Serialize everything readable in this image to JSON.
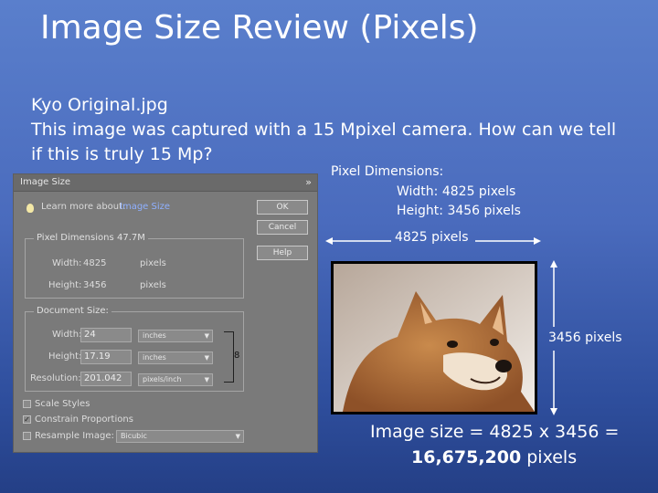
{
  "slide": {
    "title": "Image Size Review (Pixels)",
    "lines": [
      "Kyo Original.jpg",
      "This image was captured with a 15 Mpixel camera.  How can we tell",
      "if this is truly 15 Mp?"
    ]
  },
  "dialog": {
    "title": "Image Size",
    "close_icon": "close-icon",
    "learn_more": "Learn more about:",
    "learn_link": "Image Size",
    "buttons": {
      "ok": "OK",
      "cancel": "Cancel",
      "help": "Help"
    },
    "pixel_dimensions": {
      "label": "Pixel Dimensions:",
      "value": "47.7M",
      "width_label": "Width:",
      "width_value": "4825",
      "width_unit": "pixels",
      "height_label": "Height:",
      "height_value": "3456",
      "height_unit": "pixels"
    },
    "document_size": {
      "label": "Document Size:",
      "width_label": "Width:",
      "width_value": "24",
      "width_unit": "inches",
      "height_label": "Height:",
      "height_value": "17.19",
      "height_unit": "inches",
      "resolution_label": "Resolution:",
      "resolution_value": "201.042",
      "resolution_unit": "pixels/inch"
    },
    "options": {
      "scale_styles": "Scale Styles",
      "constrain": "Constrain Proportions",
      "resample": "Resample Image:",
      "resample_value": "Bicubic",
      "constrain_checked": true
    }
  },
  "info": {
    "pixel_dimensions": "Pixel Dimensions:",
    "width": "Width:  4825 pixels",
    "height": "Height:  3456 pixels",
    "width_arrow_label": "4825 pixels",
    "height_arrow_label": "3456 pixels",
    "equation_line1": "Image size = 4825 x 3456 =",
    "equation_total": "16,675,200",
    "equation_unit": " pixels"
  }
}
